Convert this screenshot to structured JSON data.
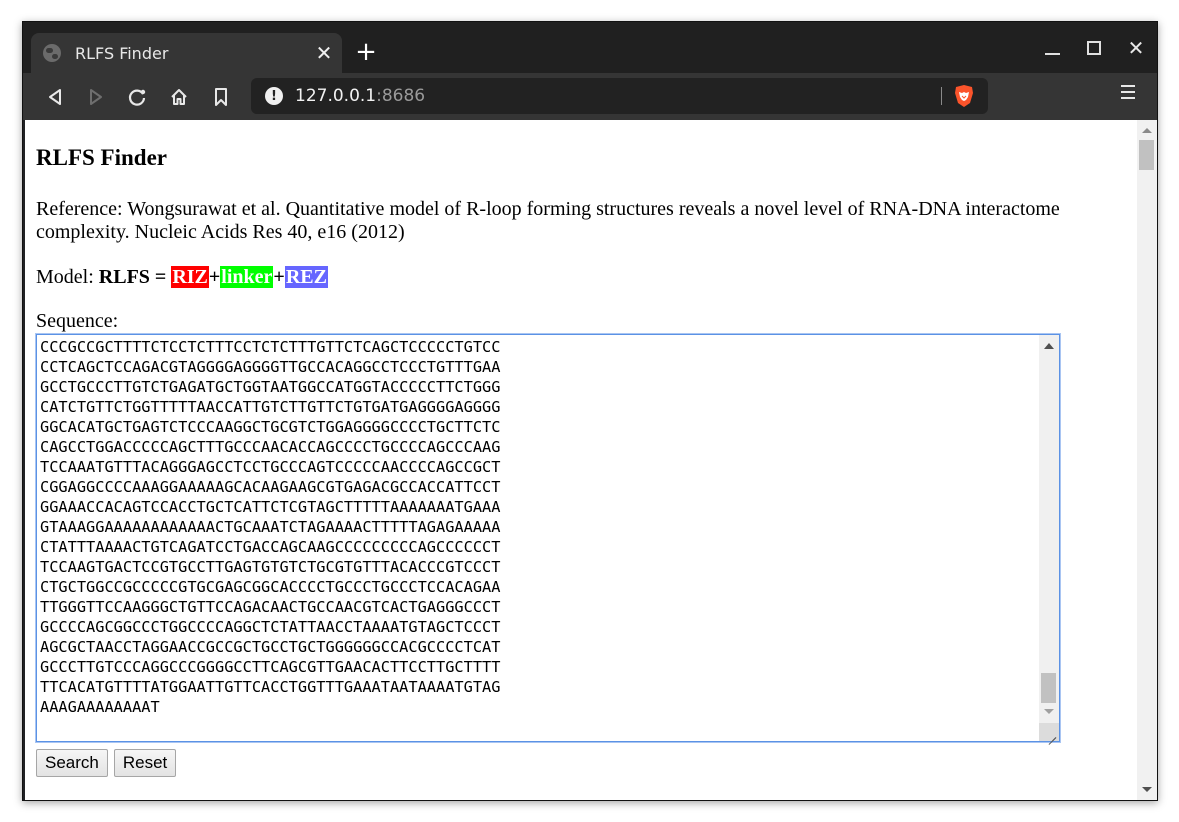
{
  "browser": {
    "tab_title": "RLFS Finder",
    "url_host": "127.0.0.1",
    "url_port": ":8686",
    "icons": {
      "tab_favicon": "globe-icon",
      "tab_close": "close-icon",
      "new_tab": "plus-icon",
      "back": "back-arrow-icon",
      "forward": "forward-arrow-icon",
      "reload": "reload-icon",
      "home": "home-icon",
      "bookmark": "bookmark-icon",
      "site_info": "info-icon",
      "brave_shields": "brave-lion-icon",
      "menu": "hamburger-menu-icon"
    },
    "glyphs": {
      "tab_close": "✕",
      "new_tab": "+",
      "win_close": "✕",
      "site_info": "!"
    }
  },
  "page": {
    "title": "RLFS Finder",
    "reference": "Reference: Wongsurawat et al. Quantitative model of R-loop forming structures reveals a novel level of RNA-DNA interactome complexity. Nucleic Acids Res 40, e16 (2012)",
    "model": {
      "prefix": "Model: ",
      "formula_lhs": "RLFS =",
      "parts": [
        {
          "label": "RIZ",
          "color": "#ff0000"
        },
        {
          "label": "linker",
          "color": "#00ff00"
        },
        {
          "label": "REZ",
          "color": "#6666ff"
        }
      ],
      "plus": "+"
    },
    "sequence_label": "Sequence:",
    "sequence_value": "CCCGCCGCTTTTCTCCTCTTTCCTCTCTTTGTTCTCAGCTCCCCCTGTCC\nCCTCAGCTCCAGACGTAGGGGAGGGGTTGCCACAGGCCTCCCTGTTTGAA\nGCCTGCCCTTGTCTGAGATGCTGGTAATGGCCATGGTACCCCCTTCTGGG\nCATCTGTTCTGGTTTTTAACCATTGTCTTGTTCTGTGATGAGGGGAGGGG\nGGCACATGCTGAGTCTCCCAAGGCTGCGTCTGGAGGGGCCCCTGCTTCTC\nCAGCCTGGACCCCCAGCTTTGCCCAACACCAGCCCCTGCCCCAGCCCAAG\nTCCAAATGTTTACAGGGAGCCTCCTGCCCAGTCCCCCAACCCCAGCCGCT\nCGGAGGCCCCAAAGGAAAAAGCACAAGAAGCGTGAGACGCCACCATTCCT\nGGAAACCACAGTCCACCTGCTCATTCTCGTAGCTTTTTAAAAAAATGAAA\nGTAAAGGAAAAAAAAAAAACTGCAAATCTAGAAAACTTTTTAGAGAAAAA\nCTATTTAAAACTGTCAGATCCTGACCAGCAAGCCCCCCCCCAGCCCCCCT\nTCCAAGTGACTCCGTGCCTTGAGTGTGTCTGCGTGTTTACACCCGTCCCT\nCTGCTGGCCGCCCCCGTGCGAGCGGCACCCCTGCCCTGCCCTCCACAGAA\nTTGGGTTCCAAGGGCTGTTCCAGACAACTGCCAACGTCACTGAGGGCCCT\nGCCCCAGCGGCCCTGGCCCCAGGCTCTATTAACCTAAAATGTAGCTCCCT\nAGCGCTAACCTAGGAACCGCCGCTGCCTGCTGGGGGGCCACGCCCCTCAT\nGCCCTTGTCCCAGGCCCGGGGCCTTCAGCGTTGAACACTTCCTTGCTTTT\nTTCACATGTTTTATGGAATTGTTCACCTGGTTTGAAATAATAAAATGTAG\nAAAGAAAAAAAAT",
    "buttons": {
      "search": "Search",
      "reset": "Reset"
    }
  }
}
